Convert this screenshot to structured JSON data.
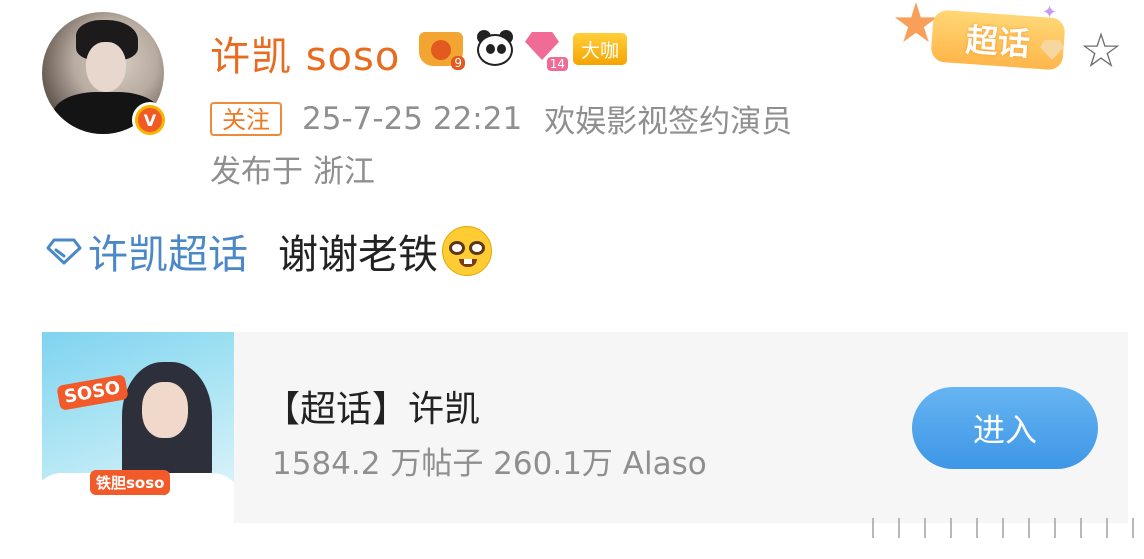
{
  "author": {
    "name": "许凯 soso",
    "badges": {
      "crown_level": "9",
      "gem_level": "14",
      "daka_label": "大咖"
    },
    "verified_icon": "v-verified-icon"
  },
  "meta": {
    "follow_label": "关注",
    "timestamp": "25-7-25 22:21",
    "source": "欢娱影视签约演员",
    "location": "发布于 浙江"
  },
  "top_right": {
    "topic_sticker_label": "超话",
    "favorite_icon": "☆"
  },
  "post": {
    "topic_link": "许凯超话",
    "text": "谢谢老铁",
    "emoji": "nerd-face-emoji"
  },
  "card": {
    "thumb_tag_main": "SOSO",
    "thumb_tag_sub": "铁胆soso",
    "title": "【超话】许凯",
    "stats": "1584.2 万帖子 260.1万 Alaso",
    "enter_label": "进入"
  },
  "colors": {
    "username": "#e86b1f",
    "link": "#4a88c7",
    "button": "#3e96e6",
    "meta": "#8f8f8f"
  }
}
